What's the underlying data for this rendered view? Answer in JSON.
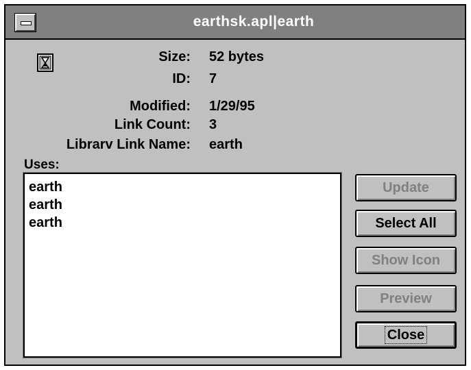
{
  "window": {
    "title": "earthsk.apl|earth",
    "sysmenu_icon": "minus-icon",
    "file_icon": "hourglass-document-icon"
  },
  "properties": [
    {
      "label": "Size:",
      "value": "52 bytes"
    },
    {
      "label": "ID:",
      "value": "7"
    },
    {
      "label": "Modified:",
      "value": "1/29/95"
    },
    {
      "label": "Link Count:",
      "value": "3"
    },
    {
      "label": "Librarv Link Name:",
      "value": "earth"
    }
  ],
  "uses": {
    "label": "Uses:",
    "items": [
      "earth",
      "earth",
      "earth"
    ]
  },
  "buttons": {
    "update": {
      "label": "Update",
      "enabled": false
    },
    "select_all": {
      "label": "Select All",
      "enabled": true
    },
    "show_icon": {
      "label": "Show Icon",
      "enabled": false
    },
    "preview": {
      "label": "Preview",
      "enabled": false
    },
    "close": {
      "label": "Close",
      "enabled": true,
      "default": true
    }
  },
  "colors": {
    "titlebar": "#808080",
    "dialog_bg": "#c0c0c0",
    "disabled_text": "#808080"
  }
}
